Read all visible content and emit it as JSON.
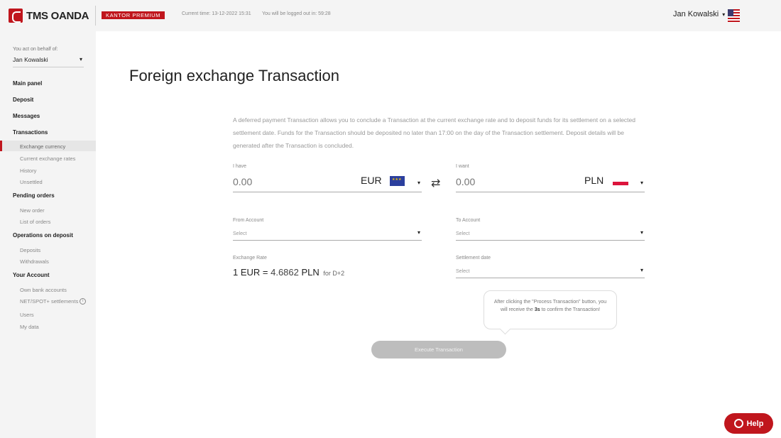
{
  "header": {
    "logo_text": "TMS OANDA",
    "badge": "KANTOR PREMIUM",
    "current_time": "Current time: 13-12-2022 15:31",
    "logout_notice": "You will be logged out in: 59:28",
    "user_name": "Jan Kowalski",
    "language_flag_icon": "us-flag-icon"
  },
  "sidebar": {
    "acting_label": "You act on behalf of:",
    "acting_value": "Jan Kowalski",
    "main_panel": "Main panel",
    "deposit": "Deposit",
    "messages": "Messages",
    "transactions": "Transactions",
    "exchange_currency": "Exchange currency",
    "current_rates": "Current exchange rates",
    "history": "History",
    "unsettled": "Unsettled",
    "pending_orders": "Pending orders",
    "new_order": "New order",
    "list_of_orders": "List of orders",
    "operations_on_deposit": "Operations on deposit",
    "deposits": "Deposits",
    "withdrawals": "Withdrawals",
    "your_account": "Your Account",
    "own_bank_accounts": "Own bank accounts",
    "net_spot_settlements": "NET/SPOT+ settlements",
    "users": "Users",
    "my_data": "My data"
  },
  "main": {
    "title": "Foreign exchange Transaction",
    "intro": "A deferred payment Transaction allows you to conclude a Transaction at the current exchange rate and to deposit funds for its settlement on a selected settlement date. Funds for the Transaction should be deposited no later than 17:00 on the day of the Transaction settlement. Deposit details will be generated after the Transaction is concluded.",
    "have_label": "I have",
    "have_value": "0.00",
    "have_currency": "EUR",
    "want_label": "I want",
    "want_value": "0.00",
    "want_currency": "PLN",
    "from_account_label": "From Account",
    "from_account_value": "Select",
    "to_account_label": "To Account",
    "to_account_value": "Select",
    "rate_label": "Exchange Rate",
    "rate_prefix": "1 EUR = ",
    "rate_number": "4.6862",
    "rate_currency": " PLN",
    "rate_suffix": "for D+2",
    "settlement_label": "Settlement date",
    "settlement_value": "Select",
    "tooltip_part1": "After clicking the \"Process Transaction\" button, you will receive the ",
    "tooltip_bold": "3s",
    "tooltip_part2": " to confirm the Transaction!",
    "execute_button": "Execute Transaction",
    "help_button": "Help"
  }
}
